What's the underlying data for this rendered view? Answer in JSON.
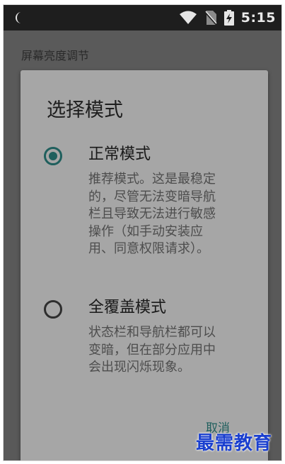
{
  "status_bar": {
    "time": "5:15",
    "icons": [
      "moon-icon",
      "wifi-icon",
      "no-sim-icon",
      "battery-charging-icon"
    ]
  },
  "app_bar": {
    "title": "屏幕亮度调节"
  },
  "dialog": {
    "title": "选择模式",
    "options": [
      {
        "label": "正常模式",
        "description": "推荐模式。这是最稳定的，尽管无法变暗导航栏且导致无法进行敏感操作（如手动安装应用、同意权限请求）。",
        "selected": true
      },
      {
        "label": "全覆盖模式",
        "description": "状态栏和导航栏都可以变暗，但在部分应用中会出现闪烁现象。",
        "selected": false
      }
    ],
    "cancel_label": "取消"
  },
  "watermark": "最需教育",
  "colors": {
    "accent": "#1f5f5d",
    "dialog_bg": "#a6a6a6",
    "status_bar": "#1e1e1e"
  }
}
